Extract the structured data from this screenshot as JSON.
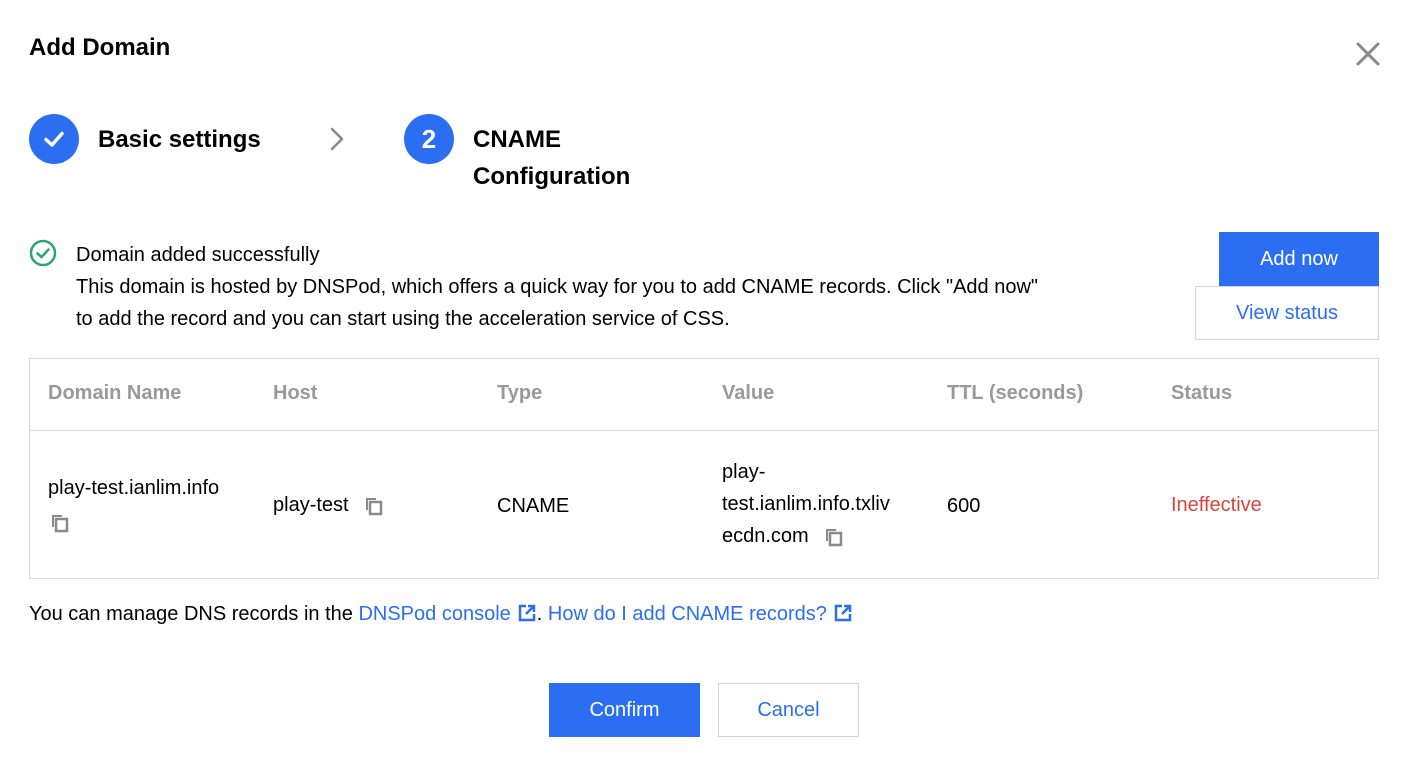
{
  "dialog": {
    "title": "Add Domain",
    "close_icon": "close-icon"
  },
  "steps": [
    {
      "label": "Basic settings",
      "status": "completed",
      "icon": "check-icon"
    },
    {
      "number": "2",
      "label_line1": "CNAME",
      "label_line2": "Configuration",
      "status": "active"
    }
  ],
  "notice": {
    "icon": "check-circle-icon",
    "title": "Domain added successfully",
    "line1": "This domain is hosted by DNSPod, which offers a quick way for you to add CNAME records. Click \"Add now\"",
    "line2": "to add the record and you can start using the acceleration service of CSS."
  },
  "actions": {
    "add_now": "Add now",
    "view_status": "View status"
  },
  "table": {
    "columns": [
      "Domain Name",
      "Host",
      "Type",
      "Value",
      "TTL (seconds)",
      "Status"
    ],
    "rows": [
      {
        "domain_name": "play-test.ianlim.info",
        "host": "play-test",
        "type": "CNAME",
        "value_line1": "play-",
        "value_line2": "test.ianlim.info.txliv",
        "value_line3": "ecdn.com",
        "ttl": "600",
        "status": "Ineffective"
      }
    ]
  },
  "footer": {
    "prefix": "You can manage DNS records in the ",
    "console_link": "DNSPod console",
    "separator": ". ",
    "help_link": "How do I add CNAME records?"
  },
  "buttons": {
    "confirm": "Confirm",
    "cancel": "Cancel"
  },
  "colors": {
    "primary": "#2b6ef2",
    "success": "#2ba471",
    "error": "#d9443d",
    "header_text": "#999999"
  }
}
